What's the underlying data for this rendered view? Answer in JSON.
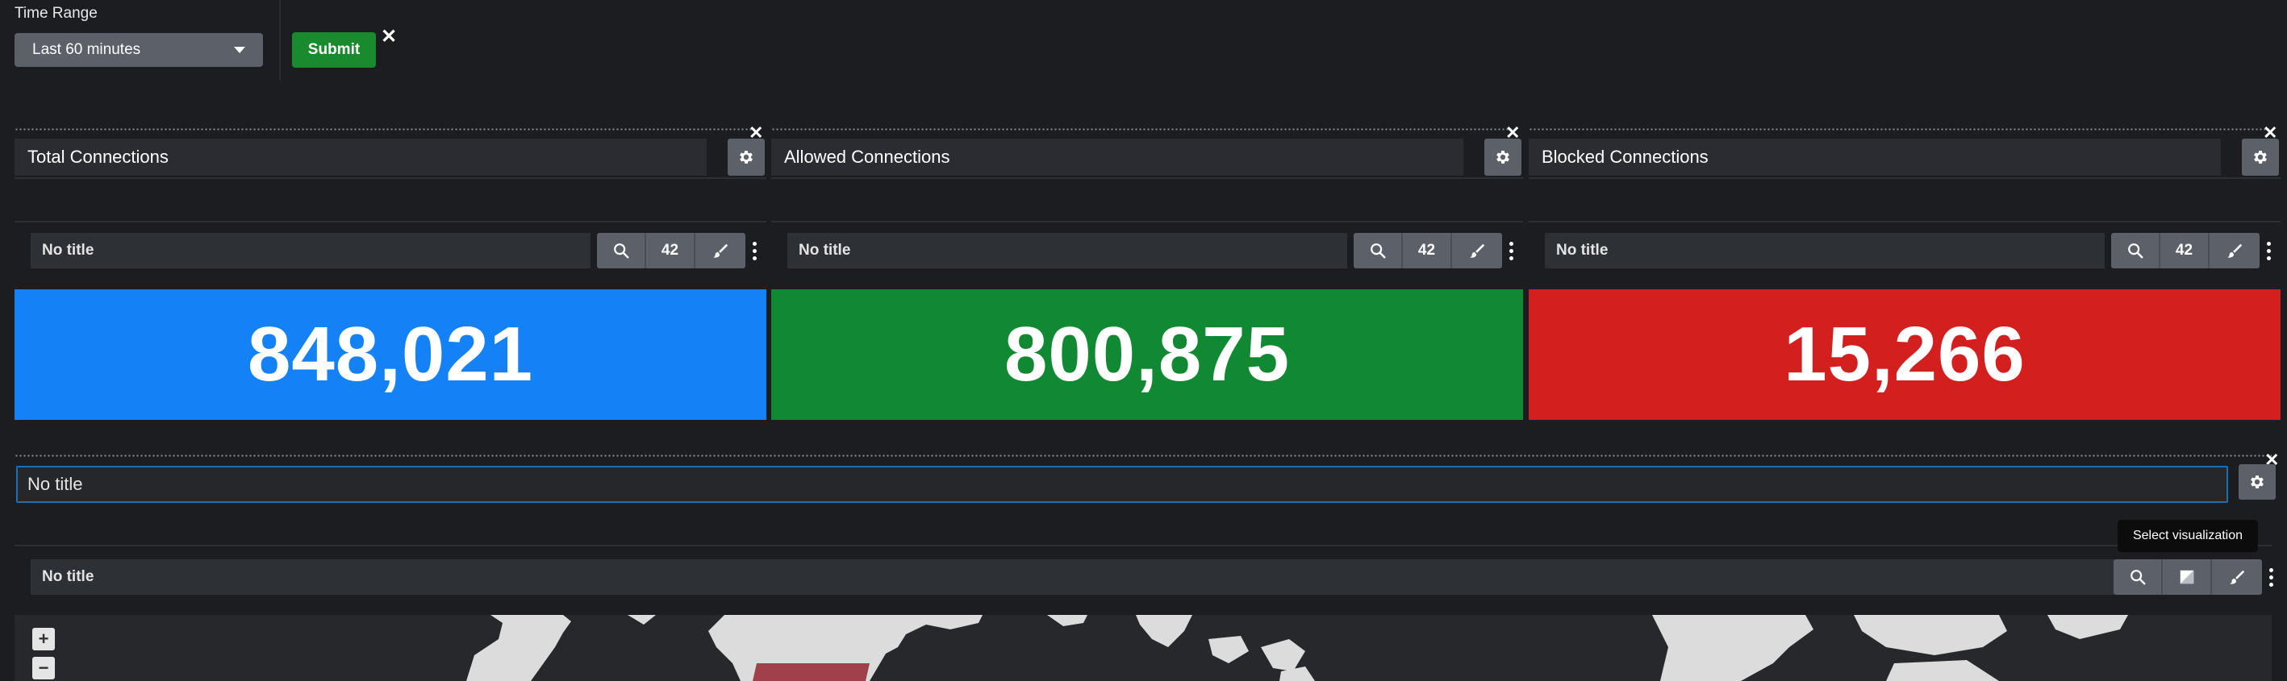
{
  "filters": {
    "time_range_label": "Time Range",
    "time_range_value": "Last 60 minutes",
    "submit_label": "Submit",
    "close_symbol": "✕"
  },
  "panels": [
    {
      "title": "Total Connections",
      "sub_title": "No title",
      "count": "42",
      "value": "848,021",
      "color": "#1482f5"
    },
    {
      "title": "Allowed Connections",
      "sub_title": "No title",
      "count": "42",
      "value": "800,875",
      "color": "#118832"
    },
    {
      "title": "Blocked Connections",
      "sub_title": "No title",
      "count": "42",
      "value": "15,266",
      "color": "#d41f1f"
    }
  ],
  "map_panel": {
    "title_input": "No title",
    "sub_title": "No title",
    "tooltip": "Select visualization",
    "zoom_in": "+",
    "zoom_out": "−"
  },
  "icons": [
    "gear-icon",
    "search-icon",
    "paintbrush-icon",
    "kebab-menu-icon",
    "close-icon",
    "caret-down-icon",
    "visualization-icon"
  ]
}
